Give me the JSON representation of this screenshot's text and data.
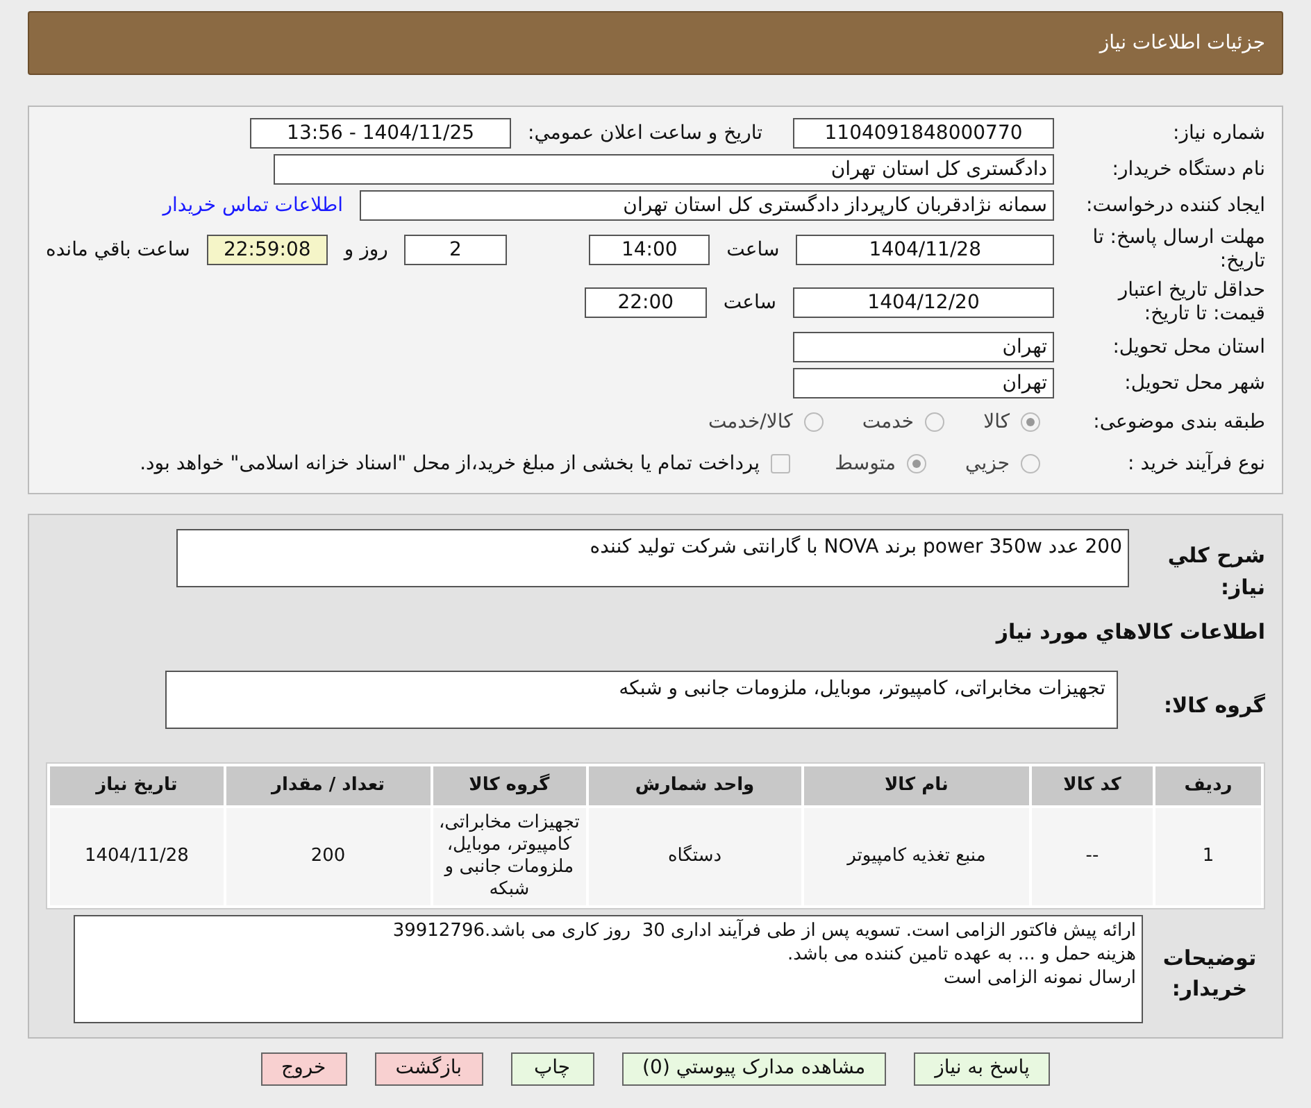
{
  "header": {
    "title": "جزئیات اطلاعات نیاز"
  },
  "need_number": {
    "label": "شماره نیاز:",
    "value": "1104091848000770"
  },
  "announce": {
    "label": "تاریخ و ساعت اعلان عمومي:",
    "value": "1404/11/25 - 13:56"
  },
  "buyer": {
    "label": "نام دستگاه خريدار:",
    "value": "دادگستری کل استان تهران"
  },
  "requester": {
    "label": "ايجاد کننده درخواست:",
    "value": "سمانه نژادقربان کارپرداز دادگستری کل استان تهران",
    "link": "اطلاعات تماس خريدار"
  },
  "deadline": {
    "label": "مهلت ارسال پاسخ: تا تاريخ:",
    "date": "1404/11/28",
    "time_label": "ساعت",
    "time": "14:00",
    "days": "2",
    "days_label": "روز و",
    "remaining": "22:59:08",
    "remaining_label": "ساعت باقي مانده"
  },
  "validity": {
    "label": "حداقل تاريخ اعتبار قيمت: تا تاريخ:",
    "date": "1404/12/20",
    "time_label": "ساعت",
    "time": "22:00"
  },
  "province": {
    "label": "استان محل تحويل:",
    "value": "تهران"
  },
  "city": {
    "label": "شهر محل تحويل:",
    "value": "تهران"
  },
  "category": {
    "label": "طبقه بندی موضوعی:",
    "options": [
      {
        "label": "کالا",
        "selected": true
      },
      {
        "label": "خدمت",
        "selected": false
      },
      {
        "label": "کالا/خدمت",
        "selected": false
      }
    ]
  },
  "process": {
    "label": "نوع فرآيند خريد :",
    "options": [
      {
        "label": "جزيي",
        "selected": false
      },
      {
        "label": "متوسط",
        "selected": true
      }
    ],
    "payment": {
      "label": "پرداخت تمام یا بخشی از مبلغ خرید،از محل \"اسناد خزانه اسلامی\" خواهد بود.",
      "checked": false
    }
  },
  "summary": {
    "label": "شرح کلي نياز:",
    "value": "200 عدد power 350w برند NOVA با گارانتی شرکت تولید کننده"
  },
  "goods_title": "اطلاعات کالاهاي مورد نياز",
  "goods_group": {
    "label": "گروه کالا:",
    "value": "تجهیزات مخابراتی، کامپیوتر، موبایل، ملزومات جانبی و شبکه"
  },
  "table": {
    "columns": [
      "رديف",
      "کد کالا",
      "نام کالا",
      "واحد شمارش",
      "گروه کالا",
      "تعداد / مقدار",
      "تاريخ نياز"
    ],
    "rows": [
      [
        "1",
        "--",
        "منبع تغذیه کامپیوتر",
        "دستگاه",
        "تجهیزات مخابراتی، کامپیوتر، موبایل، ملزومات جانبی و شبکه",
        "200",
        "1404/11/28"
      ]
    ]
  },
  "notes": {
    "label": "توضيحات خريدار:",
    "lines": [
      "ارائه پیش فاکتور الزامی است. تسویه پس از طی فرآیند اداری 30  روز کاری می باشد.39912796",
      "هزینه حمل و ... به عهده تامین کننده می باشد.",
      "ارسال نمونه الزامی است"
    ]
  },
  "buttons": [
    {
      "label": "پاسخ به نياز",
      "kind": "normal"
    },
    {
      "label": "مشاهده مدارک پيوستي (0)",
      "kind": "normal"
    },
    {
      "label": "چاپ",
      "kind": "normal"
    },
    {
      "label": "بازگشت",
      "kind": "danger"
    },
    {
      "label": "خروج",
      "kind": "danger"
    }
  ]
}
